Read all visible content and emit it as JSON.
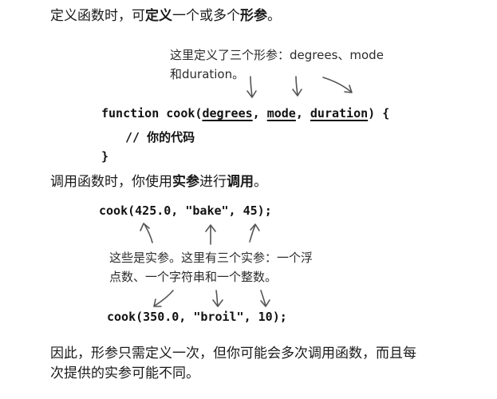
{
  "para1": {
    "part1": "定义函数时，可",
    "bold1": "定义",
    "part2": "一个或多个",
    "bold2": "形参",
    "part3": "。"
  },
  "note_top": {
    "line1": "这里定义了三个形参：degrees、mode",
    "line2": "和duration。"
  },
  "code_def": {
    "prefix": "function cook(",
    "param1": "degrees",
    "sep1": ", ",
    "param2": "mode",
    "sep2": ", ",
    "param3": "duration",
    "suffix": ") {",
    "comment": "// 你的代码",
    "close": "}"
  },
  "para2": {
    "part1": "调用函数时，你使用",
    "bold1": "实参",
    "part2": "进行",
    "bold2": "调用",
    "part3": "。"
  },
  "code_call1": "cook(425.0, \"bake\", 45);",
  "note_mid": {
    "line1": "这些是实参。这里有三个实参：一个浮",
    "line2": "点数、一个字符串和一个整数。"
  },
  "code_call2": "cook(350.0, \"broil\", 10);",
  "para3": {
    "line1": "因此，形参只需定义一次，但你可能会多次调用函数，而且每",
    "line2": "次提供的实参可能不同。"
  }
}
